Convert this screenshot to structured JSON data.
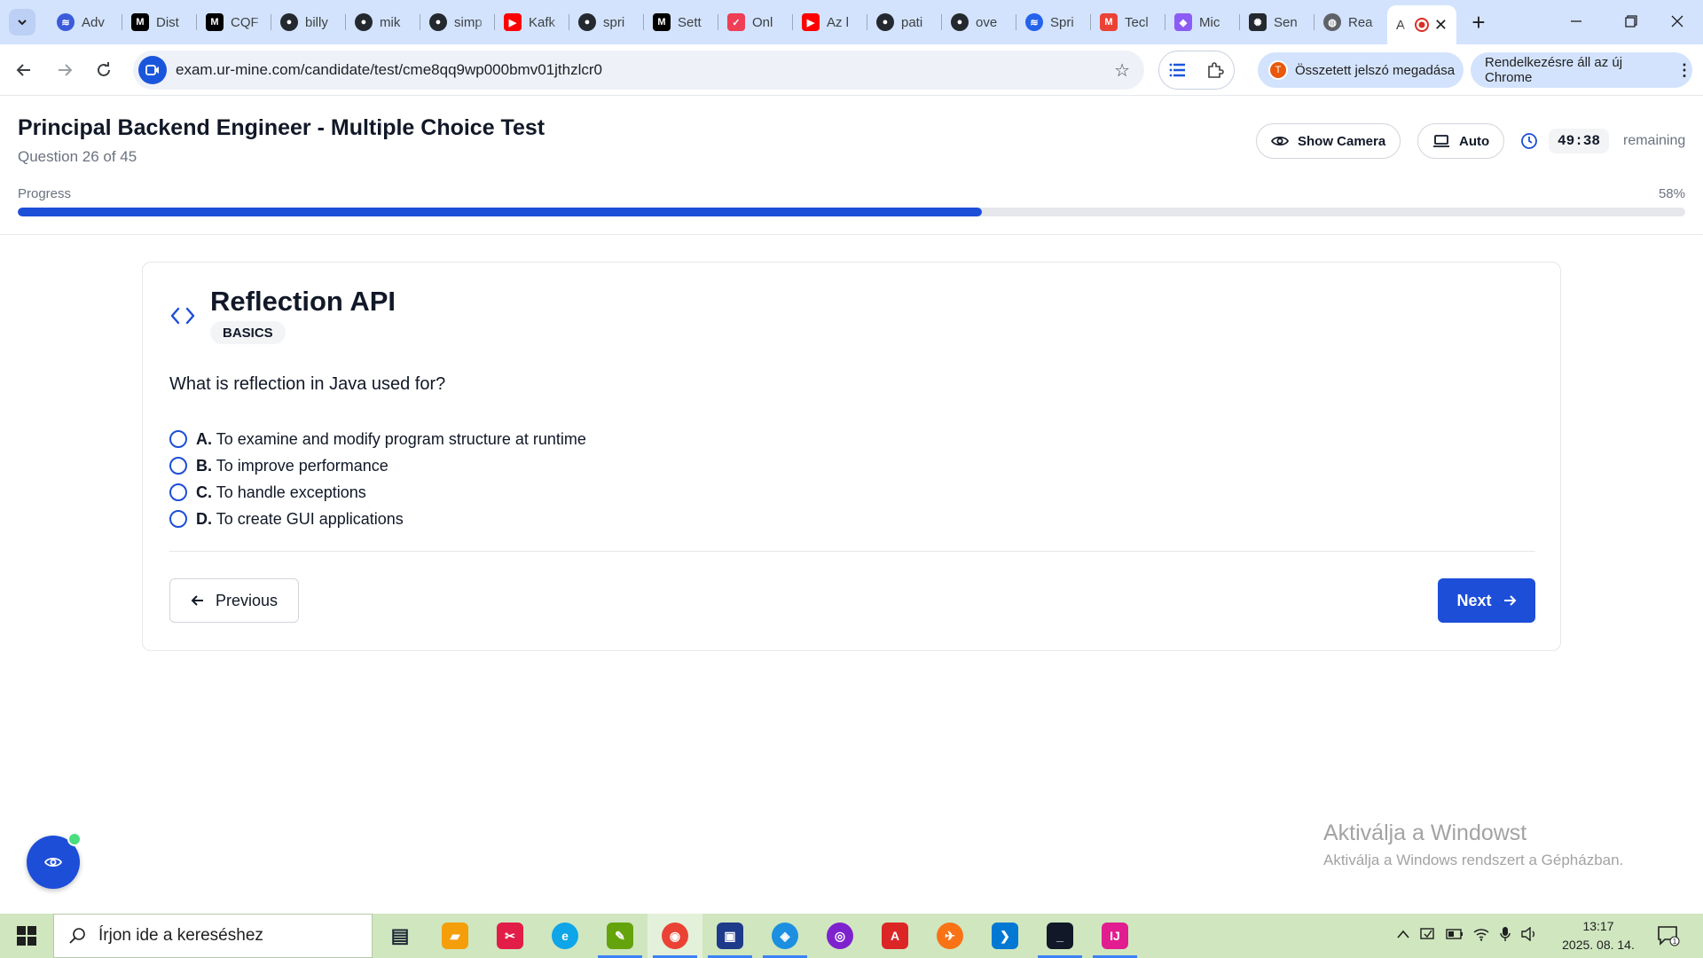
{
  "browser": {
    "tabs": [
      {
        "title": "Adv",
        "icon": "page-icon",
        "color": "#3b5bdb"
      },
      {
        "title": "Dist",
        "icon": "medium-icon",
        "color": "#000000"
      },
      {
        "title": "CQF",
        "icon": "medium-icon",
        "color": "#000000"
      },
      {
        "title": "billy",
        "icon": "github-icon",
        "color": "#24292f"
      },
      {
        "title": "mik",
        "icon": "github-icon",
        "color": "#24292f"
      },
      {
        "title": "simp",
        "icon": "github-icon",
        "color": "#24292f"
      },
      {
        "title": "Kafk",
        "icon": "youtube-icon",
        "color": "#ff0000"
      },
      {
        "title": "spri",
        "icon": "github-icon",
        "color": "#24292f"
      },
      {
        "title": "Sett",
        "icon": "medium-icon",
        "color": "#000000"
      },
      {
        "title": "Onl",
        "icon": "pocket-icon",
        "color": "#ef3f56"
      },
      {
        "title": "Az l",
        "icon": "youtube-icon",
        "color": "#ff0000"
      },
      {
        "title": "pati",
        "icon": "github-icon",
        "color": "#24292f"
      },
      {
        "title": "ove",
        "icon": "github-icon",
        "color": "#24292f"
      },
      {
        "title": "Spri",
        "icon": "page-icon",
        "color": "#2563eb"
      },
      {
        "title": "Tecl",
        "icon": "gmail-icon",
        "color": "#ea4335"
      },
      {
        "title": "Mic",
        "icon": "copilot-icon",
        "color": "#8b5cf6"
      },
      {
        "title": "Sen",
        "icon": "openai-icon",
        "color": "#24292f"
      },
      {
        "title": "Rea",
        "icon": "globe-icon",
        "color": "#5f6368"
      }
    ],
    "active_tab": {
      "title": "A",
      "icon": "record-icon"
    },
    "url": "exam.ur-mine.com/candidate/test/cme8qq9wp000bmv01jthzlcr0",
    "password_chip": "Összetett jelszó megadása",
    "password_chip_avatar": "T",
    "update_chip": "Rendelkezésre áll az új Chrome"
  },
  "header": {
    "title": "Principal Backend Engineer - Multiple Choice Test",
    "question_count": "Question 26 of 45",
    "show_camera_label": "Show Camera",
    "auto_label": "Auto",
    "timer": "49:38",
    "remaining_label": "remaining",
    "progress_label": "Progress",
    "progress_percent_text": "58%",
    "progress_value": 0.578
  },
  "question": {
    "topic": "Reflection API",
    "badge": "BASICS",
    "text": "What is reflection in Java used for?",
    "options": [
      {
        "letter": "A.",
        "text": "To examine and modify program structure at runtime"
      },
      {
        "letter": "B.",
        "text": "To improve performance"
      },
      {
        "letter": "C.",
        "text": "To handle exceptions"
      },
      {
        "letter": "D.",
        "text": "To create GUI applications"
      }
    ],
    "previous_label": "Previous",
    "next_label": "Next"
  },
  "watermark": {
    "title": "Aktiválja a Windowst",
    "subtitle": "Aktiválja a Windows rendszert a Gépházban."
  },
  "taskbar": {
    "search_placeholder": "Írjon ide a kereséshez",
    "apps": [
      {
        "name": "task-view-icon",
        "color": "#1f2937",
        "running": false,
        "active": false
      },
      {
        "name": "file-explorer-icon",
        "color": "#f59e0b",
        "running": false,
        "active": false
      },
      {
        "name": "snipping-tool-icon",
        "color": "#e11d48",
        "running": false,
        "active": false
      },
      {
        "name": "edge-icon",
        "color": "#0ea5e9",
        "running": false,
        "active": false
      },
      {
        "name": "image-editor-icon",
        "color": "#65a30d",
        "running": true,
        "active": false
      },
      {
        "name": "chrome-icon",
        "color": "#ea4335",
        "running": true,
        "active": true
      },
      {
        "name": "save-disk-icon",
        "color": "#1e3a8a",
        "running": true,
        "active": false
      },
      {
        "name": "docker-icon",
        "color": "#1d8fe1",
        "running": true,
        "active": false
      },
      {
        "name": "tor-browser-icon",
        "color": "#7e22ce",
        "running": false,
        "active": false
      },
      {
        "name": "acrobat-icon",
        "color": "#dc2626",
        "running": false,
        "active": false
      },
      {
        "name": "postman-icon",
        "color": "#f97316",
        "running": false,
        "active": false
      },
      {
        "name": "vscode-icon",
        "color": "#0078d4",
        "running": false,
        "active": false
      },
      {
        "name": "terminal-icon",
        "color": "#111827",
        "running": true,
        "active": false
      },
      {
        "name": "intellij-icon",
        "color": "#e11d8f",
        "running": true,
        "active": false
      }
    ],
    "time": "13:17",
    "date": "2025. 08. 14.",
    "notification_count": "1"
  }
}
